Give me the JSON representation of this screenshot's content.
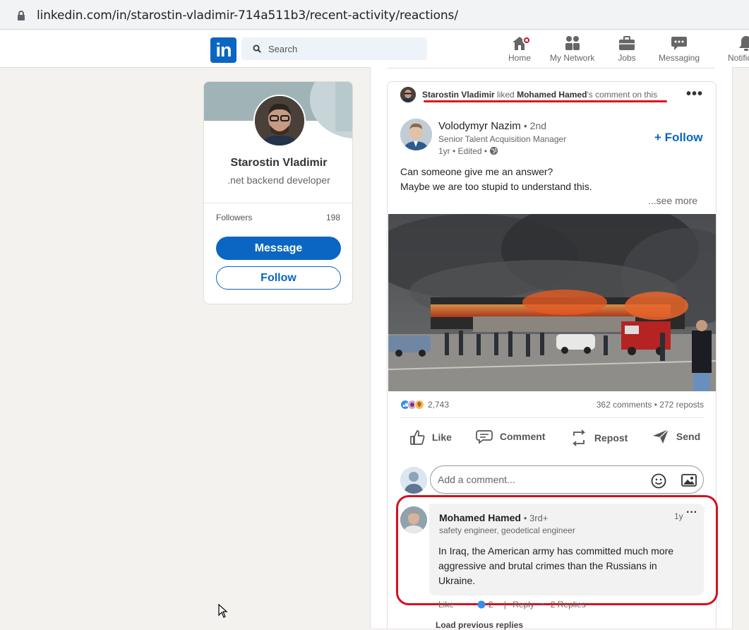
{
  "browser": {
    "url": "linkedin.com/in/starostin-vladimir-714a511b3/recent-activity/reactions/"
  },
  "header": {
    "logo_text": "in",
    "search_placeholder": "Search",
    "nav": [
      {
        "label": "Home",
        "icon": "home-icon"
      },
      {
        "label": "My Network",
        "icon": "network-icon"
      },
      {
        "label": "Jobs",
        "icon": "briefcase-icon"
      },
      {
        "label": "Messaging",
        "icon": "messaging-icon"
      },
      {
        "label": "Notificatio",
        "icon": "bell-icon"
      }
    ]
  },
  "profile": {
    "name": "Starostin Vladimir",
    "title": ".net backend developer",
    "followers_label": "Followers",
    "followers_count": "198",
    "message_button": "Message",
    "follow_button": "Follow"
  },
  "activity": {
    "actor": "Starostin Vladimir",
    "verb": "liked",
    "target": "Mohamed Hamed",
    "suffix": "'s comment on this"
  },
  "post": {
    "author_name": "Volodymyr Nazim",
    "author_degree": "• 2nd",
    "author_headline": "Senior Talent Acquisition Manager",
    "meta": "1yr • Edited •",
    "follow_label": "+ Follow",
    "text_line1": "Can someone give me an answer?",
    "text_line2": "Maybe we are too stupid to understand this.",
    "see_more": "...see more",
    "reactions_count": "2,743",
    "comments_reposts": "362 comments • 272 reposts",
    "actions": {
      "like": "Like",
      "comment": "Comment",
      "repost": "Repost",
      "send": "Send"
    },
    "comment_placeholder": "Add a comment..."
  },
  "comment": {
    "author": "Mohamed Hamed",
    "degree": "• 3rd+",
    "headline": "safety engineer, geodetical engineer",
    "time": "1y",
    "text": "In Iraq, the American army has committed much more aggressive and brutal crimes than the Russians in Ukraine.",
    "like": "Like",
    "like_count": "2",
    "reply": "Reply",
    "replies": "2 Replies",
    "load_previous": "Load previous replies"
  },
  "colors": {
    "linkedin_blue": "#0a66c2",
    "highlight_red": "#d4121f",
    "notification_red": "#cb112d"
  }
}
